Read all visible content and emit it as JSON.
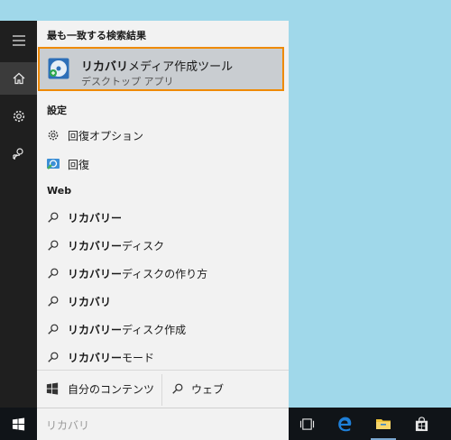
{
  "menu": {
    "best_match_header": "最も一致する検索結果",
    "best_match": {
      "title_bold": "リカバリ",
      "title_rest": "メディア作成ツール",
      "subtitle": "デスクトップ アプリ"
    },
    "settings_header": "設定",
    "settings_items": [
      {
        "label": "回復オプション",
        "icon": "gear-icon"
      },
      {
        "label": "回復",
        "icon": "recovery-icon"
      }
    ],
    "web_header": "Web",
    "web_items": [
      {
        "bold": "リカバリー",
        "rest": ""
      },
      {
        "bold": "リカバリー",
        "rest": "ディスク"
      },
      {
        "bold": "リカバリー",
        "rest": "ディスクの作り方"
      },
      {
        "bold": "リカバリ",
        "rest": ""
      },
      {
        "bold": "リカバリー",
        "rest": "ディスク作成"
      },
      {
        "bold": "リカバリー",
        "rest": "モード"
      }
    ],
    "my_content_label": "自分のコンテンツ",
    "web_button_label": "ウェブ"
  },
  "search": {
    "query": "リカバリ"
  },
  "colors": {
    "highlight_border": "#ef8a00",
    "desktop": "#a0d8ea",
    "taskbar": "#101418",
    "edge_blue": "#1e7fd8"
  }
}
